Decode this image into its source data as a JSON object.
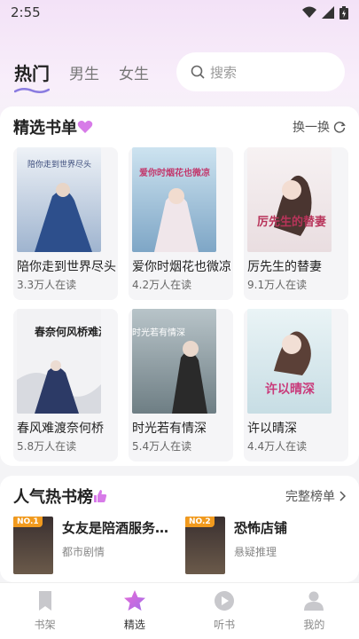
{
  "status": {
    "time": "2:55"
  },
  "tabs": [
    {
      "label": "热门",
      "active": true
    },
    {
      "label": "男生",
      "active": false
    },
    {
      "label": "女生",
      "active": false
    }
  ],
  "search": {
    "placeholder": "搜索"
  },
  "picks": {
    "title": "精选书单",
    "action": "换一换",
    "books": [
      {
        "title": "陪你走到世界尽头",
        "readers": "3.3万人在读",
        "cover_text": "陪你走到世界尽头"
      },
      {
        "title": "爱你时烟花也微凉",
        "readers": "4.2万人在读",
        "cover_text": "爱你时烟花也微凉"
      },
      {
        "title": "厉先生的替妻",
        "readers": "9.1万人在读",
        "cover_text": "厉先生的替妻"
      },
      {
        "title": "春风难渡奈何桥",
        "readers": "5.8万人在读",
        "cover_text": "春奈何风桥难渡"
      },
      {
        "title": "时光若有情深",
        "readers": "5.4万人在读",
        "cover_text": "时光若有情深"
      },
      {
        "title": "许以晴深",
        "readers": "4.4万人在读",
        "cover_text": "许以晴深"
      }
    ]
  },
  "hot": {
    "title": "人气热书榜",
    "action": "完整榜单",
    "items": [
      {
        "badge": "NO.1",
        "title": "女友是陪酒服务…",
        "genre": "都市剧情"
      },
      {
        "badge": "NO.2",
        "title": "恐怖店铺",
        "genre": "悬疑推理"
      }
    ]
  },
  "nav": [
    {
      "label": "书架",
      "active": false
    },
    {
      "label": "精选",
      "active": true
    },
    {
      "label": "听书",
      "active": false
    },
    {
      "label": "我的",
      "active": false
    }
  ],
  "colors": {
    "accent": "#e05bd0",
    "badge": "#f19a1e"
  }
}
